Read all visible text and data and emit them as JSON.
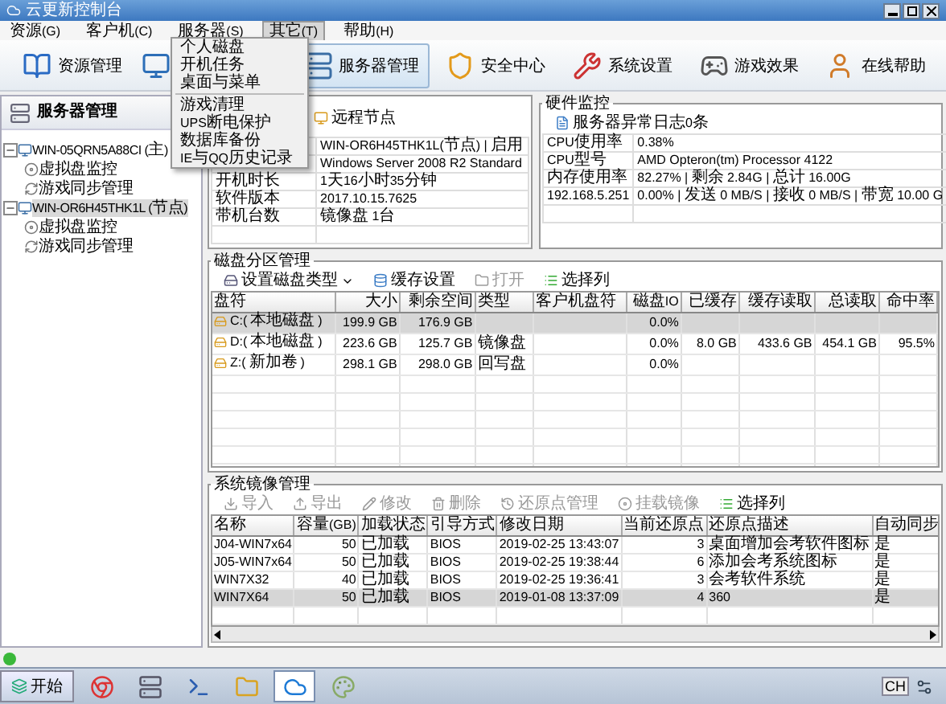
{
  "window": {
    "title": "云更新控制台"
  },
  "menu_bar": [
    {
      "label": "资源(G)",
      "open": false
    },
    {
      "label": "客户机(C)",
      "open": false
    },
    {
      "label": "服务器(S)",
      "open": false
    },
    {
      "label": "其它(T)",
      "open": true
    },
    {
      "label": "帮助(H)",
      "open": false
    }
  ],
  "open_menu": {
    "items": [
      {
        "kind": "item",
        "label": "个人磁盘"
      },
      {
        "kind": "item",
        "label": "开机任务"
      },
      {
        "kind": "item",
        "label": "桌面与菜单"
      },
      {
        "kind": "separator"
      },
      {
        "kind": "item",
        "label": "游戏清理"
      },
      {
        "kind": "item",
        "label": "UPS断电保护"
      },
      {
        "kind": "item",
        "label": "数据库备份"
      },
      {
        "kind": "item",
        "label": "IE与QQ历史记录"
      }
    ]
  },
  "toolbar": [
    {
      "kind": "book",
      "label": "资源管理",
      "selected": false
    },
    {
      "kind": "monitor",
      "selected": false
    },
    {
      "kind": "server",
      "label": "服务器管理",
      "selected": true
    },
    {
      "kind": "shield",
      "label": "安全中心",
      "selected": false
    },
    {
      "kind": "tools",
      "label": "系统设置",
      "selected": false
    },
    {
      "kind": "gamepad",
      "label": "游戏效果",
      "selected": false
    },
    {
      "kind": "person",
      "label": "在线帮助",
      "selected": false
    }
  ],
  "sidebar": {
    "title": "服务器管理",
    "tree": [
      {
        "label": "WIN-05QRN5A88CI (主)",
        "expanded": true,
        "selected": false,
        "children": [
          {
            "label": "虚拟盘监控",
            "kind": "disk"
          },
          {
            "label": "游戏同步管理",
            "kind": "sync"
          }
        ]
      },
      {
        "label": "WIN-OR6H45THK1L (节点)",
        "expanded": true,
        "selected": true,
        "children": [
          {
            "label": "虚拟盘监控",
            "kind": "disk"
          },
          {
            "label": "游戏同步管理",
            "kind": "sync"
          }
        ]
      }
    ]
  },
  "node_panel": {
    "header": "远程节点",
    "rows": [
      {
        "value": "WIN-OR6H45THK1L(节点) | 启用"
      },
      {
        "value": "Windows Server 2008 R2 Standard"
      },
      {
        "label": "开机时长",
        "value": "1天16小时35分钟"
      },
      {
        "label": "软件版本",
        "value": "2017.10.15.7625"
      },
      {
        "label": "带机台数",
        "value": "镜像盘 1台"
      }
    ]
  },
  "hardware_panel": {
    "title": "硬件监控",
    "log": "服务器异常日志0条",
    "rows": [
      {
        "label": "CPU使用率",
        "value": "0.38%"
      },
      {
        "label": "CPU型号",
        "value": "AMD Opteron(tm) Processor 4122"
      },
      {
        "label": "内存使用率",
        "value": "82.27% | 剩余 2.84G | 总计 16.00G"
      },
      {
        "label": "192.168.5.251",
        "value": "0.00% | 发送 0 MB/S | 接收 0 MB/S | 带宽 10.00 G"
      }
    ]
  },
  "disk_panel": {
    "title": "磁盘分区管理",
    "actions": [
      {
        "kind": "disktype",
        "label": "设置磁盘类型",
        "disabled": false
      },
      {
        "kind": "cache",
        "label": "缓存设置",
        "disabled": false
      },
      {
        "kind": "open",
        "label": "打开",
        "disabled": true
      },
      {
        "kind": "columns",
        "label": "选择列",
        "disabled": false
      }
    ],
    "columns": [
      "盘符",
      "大小",
      "剩余空间",
      "类型",
      "客户机盘符",
      "磁盘IO",
      "已缓存",
      "缓存读取",
      "总读取",
      "命中率"
    ],
    "rows": [
      {
        "selected": true,
        "cells": [
          "C:(本地磁盘)",
          "199.9 GB",
          "176.9 GB",
          "",
          "",
          "0.0%",
          "",
          "",
          "",
          ""
        ]
      },
      {
        "selected": false,
        "cells": [
          "D:(本地磁盘)",
          "223.6 GB",
          "125.7 GB",
          "镜像盘",
          "",
          "0.0%",
          "8.0 GB",
          "433.6 GB",
          "454.1 GB",
          "95.5%"
        ]
      },
      {
        "selected": false,
        "cells": [
          "Z:(新加卷)",
          "298.1 GB",
          "298.0 GB",
          "回写盘",
          "",
          "0.0%",
          "",
          "",
          "",
          ""
        ]
      }
    ]
  },
  "image_panel": {
    "title": "系统镜像管理",
    "actions": [
      {
        "kind": "import",
        "label": "导入",
        "disabled": true
      },
      {
        "kind": "export",
        "label": "导出",
        "disabled": true
      },
      {
        "kind": "edit",
        "label": "修改",
        "disabled": true
      },
      {
        "kind": "delete",
        "label": "删除",
        "disabled": true
      },
      {
        "kind": "restore",
        "label": "还原点管理",
        "disabled": true
      },
      {
        "kind": "mount",
        "label": "挂载镜像",
        "disabled": true
      },
      {
        "kind": "columns",
        "label": "选择列",
        "disabled": false
      }
    ],
    "columns": [
      "名称",
      "容量(GB)",
      "加载状态",
      "引导方式",
      "修改日期",
      "当前还原点",
      "还原点描述",
      "自动同步"
    ],
    "rows": [
      {
        "selected": false,
        "cells": [
          "J04-WIN7x64",
          "50",
          "已加载",
          "BIOS",
          "2019-02-25 13:43:07",
          "3",
          "桌面增加会考软件图标",
          "是"
        ]
      },
      {
        "selected": false,
        "cells": [
          "J05-WIN7x64",
          "50",
          "已加载",
          "BIOS",
          "2019-02-25 19:38:44",
          "6",
          "添加会考系统图标",
          "是"
        ]
      },
      {
        "selected": false,
        "cells": [
          "WIN7X32",
          "40",
          "已加载",
          "BIOS",
          "2019-02-25 19:36:41",
          "3",
          "会考软件系统",
          "是"
        ]
      },
      {
        "selected": true,
        "cells": [
          "WIN7X64",
          "50",
          "已加载",
          "BIOS",
          "2019-01-08 13:37:09",
          "4",
          "360",
          "是"
        ]
      }
    ]
  },
  "status_bar": {
    "online": true
  },
  "taskbar": {
    "start": "开始",
    "apps": [
      {
        "kind": "browser",
        "selected": false
      },
      {
        "kind": "server",
        "selected": false
      },
      {
        "kind": "terminal",
        "selected": false
      },
      {
        "kind": "folder",
        "selected": false
      },
      {
        "kind": "cloud",
        "selected": true
      },
      {
        "kind": "paint",
        "selected": false
      }
    ],
    "tray": [
      "CH"
    ]
  }
}
